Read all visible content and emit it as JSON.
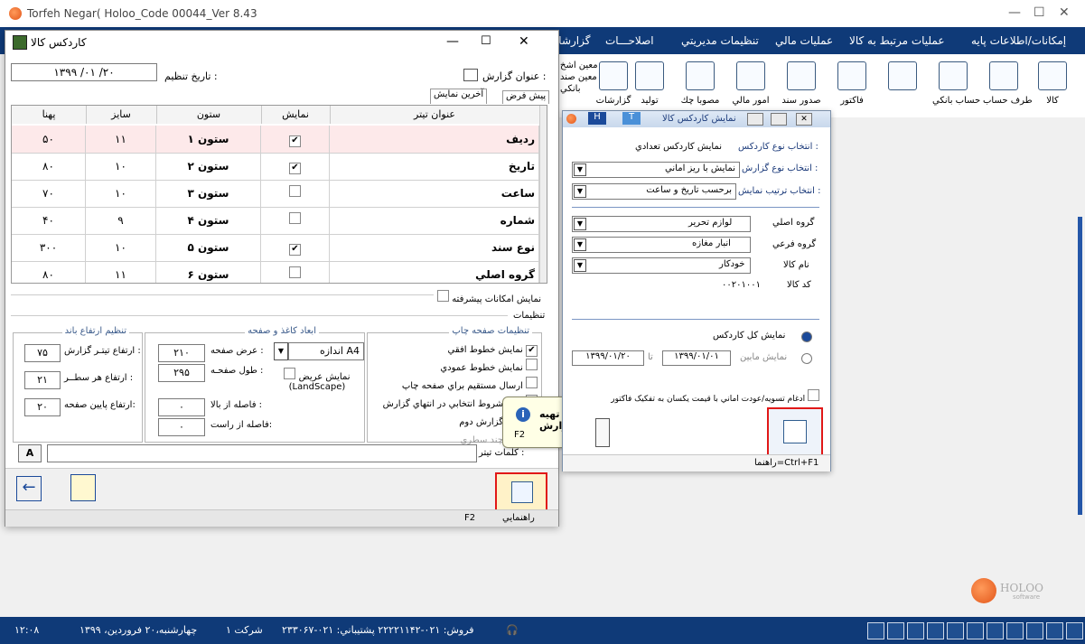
{
  "app": {
    "title": "Torfeh Negar( Holoo_Code 00044_Ver 8.43",
    "menu": [
      "إمکانات/اطلاعات پايه",
      "عمليات مرتبط به کالا",
      "عمليات مالي",
      "تنظيمات مديريتي",
      "اصلاحـــات",
      "گزارشات"
    ],
    "toolbar": [
      "کالا",
      "طرف حساب",
      "حساب بانکي",
      "",
      "فاکتور",
      "صدور سند",
      "امور مالي",
      "مصوبا چك",
      "تولید",
      "گزارشات"
    ],
    "side_labels": [
      "معين اشخ",
      "معين صند",
      "بانكي"
    ],
    "logo": "HOLOO",
    "logo_sub": "software",
    "status": {
      "time": "۱۲:۰۸",
      "date": "چهارشنبه،۲۰ فروردين، ۱۳۹۹",
      "company": "شرکت ۱",
      "phones": "فروش: ۰۲۱-۲۲۲۲۱۱۴۲ پشتيباني: ۰۲۱-۲۳۳۰۶۷"
    }
  },
  "kardex": {
    "title": "کاردکس کالا",
    "report_title_label": "عنوان گزارش :",
    "date_label": "تاريخ تنظيم :",
    "date_value": "۱۳۹۹ /۰۱ /۲۰",
    "tabs": [
      "پيش فرض",
      "آخرين نمايش"
    ],
    "columns": [
      "عنوان تيتر",
      "نمايش",
      "ستون",
      "سايز",
      "پهنا"
    ],
    "rows": [
      {
        "title": "رديف",
        "show": true,
        "col": "ستون ۱",
        "size": "۱۱",
        "width": "۵۰"
      },
      {
        "title": "تاريخ",
        "show": true,
        "col": "ستون ۲",
        "size": "۱۰",
        "width": "۸۰"
      },
      {
        "title": "ساعت",
        "show": false,
        "col": "ستون ۳",
        "size": "۱۰",
        "width": "۷۰"
      },
      {
        "title": "شماره",
        "show": false,
        "col": "ستون ۴",
        "size": "۹",
        "width": "۴۰"
      },
      {
        "title": "نوع سند",
        "show": true,
        "col": "ستون ۵",
        "size": "۱۰",
        "width": "۳۰۰"
      },
      {
        "title": "گروه اصلي",
        "show": false,
        "col": "ستون ۶",
        "size": "۱۱",
        "width": "۸۰"
      }
    ],
    "advanced": "نمايش امکانات پيشرفته",
    "settings_label": "تنظيمات",
    "print_group": "تنظيمات صفحه چاپ",
    "print_items": [
      "نمايش خطوط افقي",
      "نمايش خطوط عمودي",
      "ارسال مستقيم براي صفحه چاپ",
      "چاپ شروط انتخابي در انتهاي گزارش",
      "چاپ گزارش دوم",
      "چاپ چند سطري"
    ],
    "paper_group": "ابعاد کاغذ و صفحه",
    "paper_size": "اندازه A4",
    "page_width_label": "عرض صفحه :",
    "page_width": "۲۱۰",
    "page_height_label": "طول صفحـه :",
    "page_height": "۲۹۵",
    "landscape": "نمايش عريض (LandScape)",
    "top_margin_label": "فاصله از بالا :",
    "top_margin": "۰",
    "right_margin_label": "فاصله از راست:",
    "right_margin": "۰",
    "height_group": "تنظيم ارتفاع باند",
    "h1_label": "ارتفاع تيتـر گزارش :",
    "h1": "۷۵",
    "h2_label": "ارتفاع هر سطــر :",
    "h2": "۲۱",
    "h3_label": "ارتفاع پايين صفحه:",
    "h3": "۲۰",
    "title_field_label": "كلمات تيتر :",
    "help": "راهنمايي",
    "help_key": "F2"
  },
  "tooltip": {
    "title": "تهيه گزارش",
    "key": "F2"
  },
  "dialog": {
    "title": "نمايش کاردکس کالا",
    "kind_label": "انتخاب نوع کاردکس :",
    "kind_value": "نمايش کاردکس تعدادي",
    "report_type_label": "انتخاب نوع گزارش :",
    "report_type": "نمايش با ريز اماني",
    "order_label": "انتخاب ترتيب نمايش :",
    "order": "برحسب تاريخ و ساعت",
    "main_group_label": "گروه اصلي",
    "main_group": "لوازم تحرير",
    "sub_group_label": "گروه فرعي",
    "sub_group": "انبار مغازه",
    "item_label": "نام کالا",
    "item": "خودکار",
    "code_label": "کد کالا",
    "code": "۰۰۲۰۱۰۰۱",
    "all_label": "نمايش کل کاردکس",
    "between_label": "نمايش مابين",
    "to_label": "تا",
    "date_from": "۱۳۹۹/۰۱/۰۱",
    "date_to": "۱۳۹۹/۰۱/۲۰",
    "merge_label": "ادغام تسويه/عودت اماني با قيمت يکسان به تفکيک فاکتور",
    "help": "راهنما=Ctrl+F1"
  }
}
